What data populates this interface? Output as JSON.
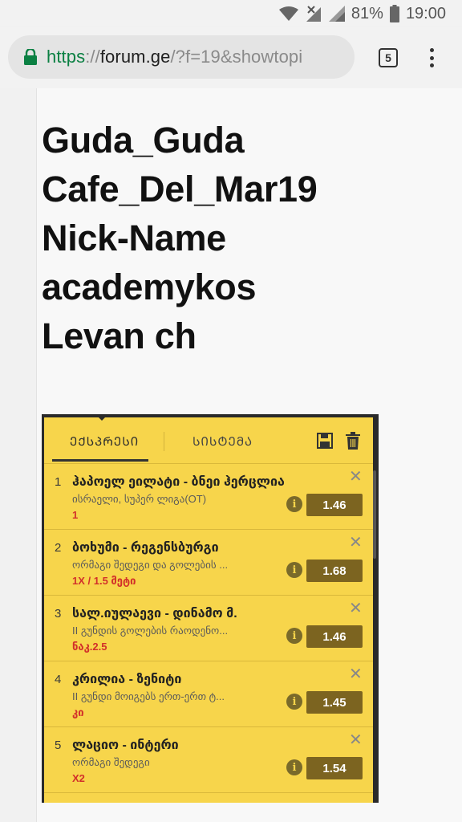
{
  "status_bar": {
    "battery": "81%",
    "time": "19:00"
  },
  "browser": {
    "url_scheme": "https",
    "url_sep": "://",
    "url_host": "forum.ge",
    "url_path": "/?f=19&showtopi",
    "tab_count": "5"
  },
  "post": {
    "names": [
      "Guda_Guda",
      "Cafe_Del_Mar19",
      "Nick-Name",
      "academykos",
      "Levan ch"
    ]
  },
  "slip": {
    "tab_express": "ᲔᲥᲡᲞᲠᲔᲡᲘ",
    "tab_system": "ᲡᲘᲡᲢᲔᲛᲐ",
    "bets": [
      {
        "num": "1",
        "match": "ჰაპოელ ეილატი - ბნეი ჰერცლია",
        "market": "ისრაელი, სუპერ ლიგა(OT)",
        "pick": "1",
        "odds": "1.46"
      },
      {
        "num": "2",
        "match": "ბოხუმი - რეგენსბურგი",
        "market": "ორმაგი შედეგი და გოლების ...",
        "pick": "1X / 1.5 მეტი",
        "odds": "1.68"
      },
      {
        "num": "3",
        "match": "სალ.იულაევი - დინამო მ.",
        "market": "II გუნდის გოლების რაოდენო...",
        "pick": "ნაკ.2.5",
        "odds": "1.46"
      },
      {
        "num": "4",
        "match": "კრილია - ზენიტი",
        "market": "II გუნდი მოიგებს ერთ-ერთ ტ...",
        "pick": "კი",
        "odds": "1.45"
      },
      {
        "num": "5",
        "match": "ლაციო - ინტერი",
        "market": "ორმაგი შედეგი",
        "pick": "X2",
        "odds": "1.54"
      }
    ]
  }
}
